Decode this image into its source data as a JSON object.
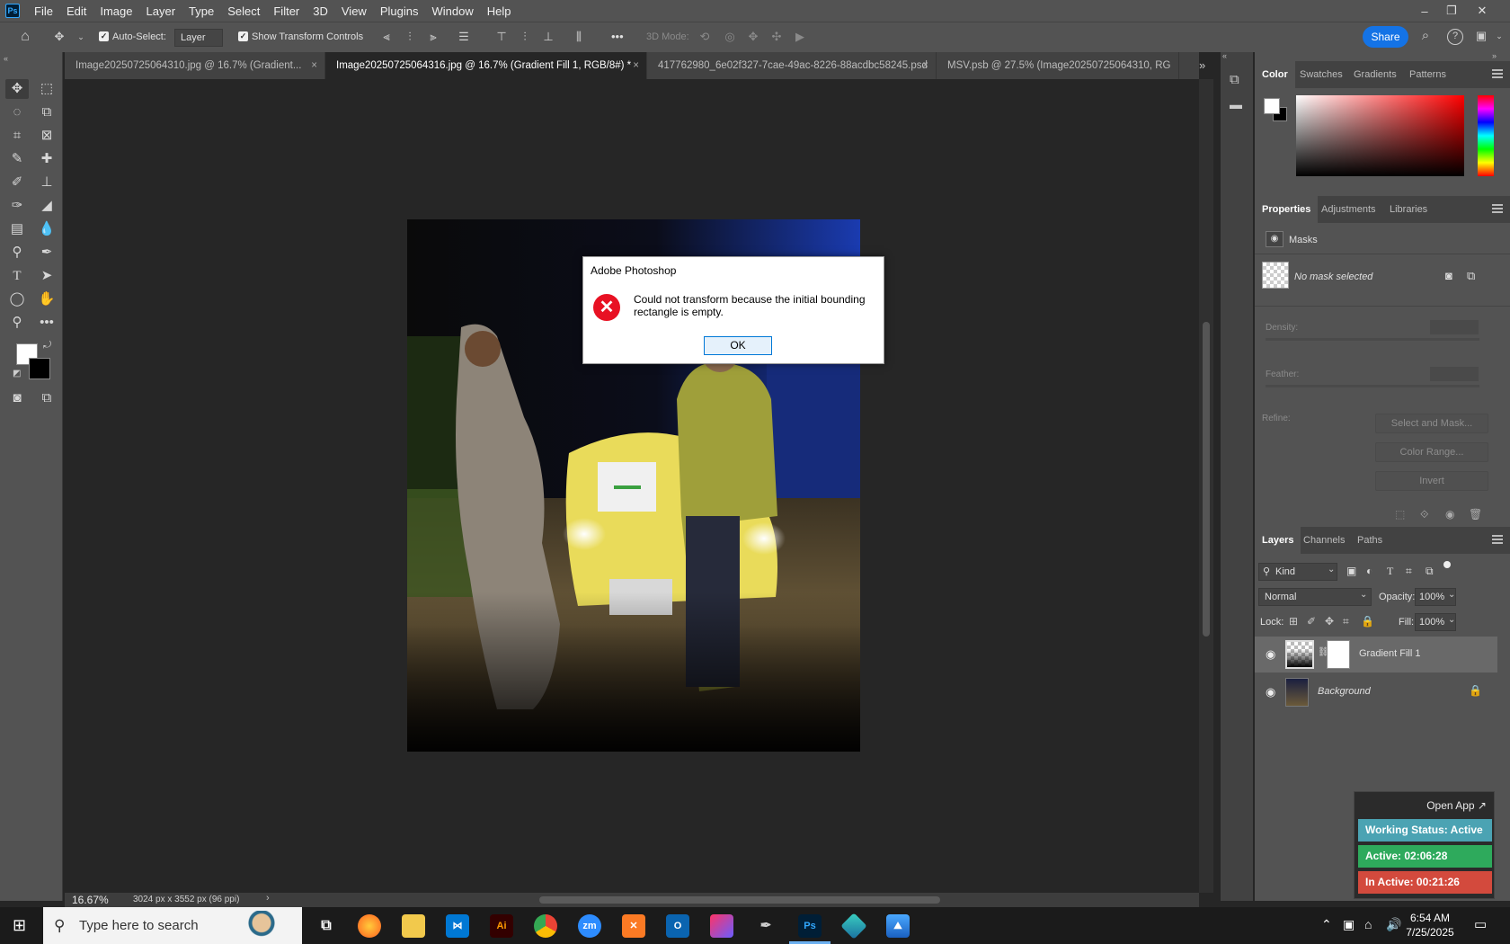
{
  "app": {
    "logo": "Ps"
  },
  "menu": [
    "File",
    "Edit",
    "Image",
    "Layer",
    "Type",
    "Select",
    "Filter",
    "3D",
    "View",
    "Plugins",
    "Window",
    "Help"
  ],
  "window_controls": {
    "minimize": "–",
    "restore": "❐",
    "close": "✕"
  },
  "options_bar": {
    "auto_select_label": "Auto-Select:",
    "auto_select_value": "Layer",
    "show_transform_label": "Show Transform Controls",
    "mode_3d_label": "3D Mode:",
    "more": "•••",
    "share_label": "Share"
  },
  "tabs": [
    {
      "label": "Image20250725064310.jpg @ 16.7% (Gradient...",
      "close": "×"
    },
    {
      "label": "Image20250725064316.jpg @ 16.7% (Gradient Fill 1, RGB/8#) *",
      "close": "×"
    },
    {
      "label": "417762980_6e02f327-7cae-49ac-8226-88acdbc58245.psd",
      "close": "×"
    },
    {
      "label": "MSV.psb @ 27.5% (Image20250725064310, RG",
      "close": ""
    }
  ],
  "tab_overflow": "»",
  "status": {
    "zoom": "16.67%",
    "doc_size": "3024 px x 3552 px (96 ppi)"
  },
  "color_panel": {
    "tabs": [
      "Color",
      "Swatches",
      "Gradients",
      "Patterns"
    ],
    "hue_gradient": [
      "#ff0000",
      "#ff00ff",
      "#0000ff",
      "#00ffff",
      "#00ff00",
      "#ffff00",
      "#ff0000"
    ]
  },
  "properties_panel": {
    "tabs": [
      "Properties",
      "Adjustments",
      "Libraries"
    ],
    "masks_label": "Masks",
    "no_mask_label": "No mask selected",
    "density_label": "Density:",
    "feather_label": "Feather:",
    "refine_label": "Refine:",
    "select_mask_btn": "Select and Mask...",
    "color_range_btn": "Color Range...",
    "invert_btn": "Invert"
  },
  "layers_panel": {
    "tabs": [
      "Layers",
      "Channels",
      "Paths"
    ],
    "kind_label": "Kind",
    "blend_mode": "Normal",
    "opacity_label": "Opacity:",
    "opacity_value": "100%",
    "lock_label": "Lock:",
    "fill_label": "Fill:",
    "fill_value": "100%",
    "layers": [
      {
        "name": "Gradient Fill 1"
      },
      {
        "name": "Background"
      }
    ]
  },
  "dialog": {
    "title": "Adobe Photoshop",
    "message": "Could not transform because the initial bounding rectangle is empty.",
    "ok_label": "OK"
  },
  "tracker_widget": {
    "open_app": "Open App ↗",
    "working_status": "Working Status: Active",
    "active": "Active: 02:06:28",
    "inactive": "In Active: 00:21:26",
    "colors": {
      "status": "#4ba3b3",
      "active": "#2eaa5c",
      "inactive": "#d34a3d"
    }
  },
  "taskbar": {
    "search_placeholder": "Type here to search",
    "time": "6:54 AM",
    "date": "7/25/2025",
    "pinned": [
      "task-view-icon",
      "firefox-icon",
      "file-explorer-icon",
      "vscode-icon",
      "illustrator-icon",
      "chrome-icon",
      "zoom-icon",
      "xampp-icon",
      "outlook-icon",
      "creative-cloud-icon",
      "pen-tool-icon",
      "photoshop-icon",
      "gem-app-icon",
      "photos-icon"
    ]
  }
}
